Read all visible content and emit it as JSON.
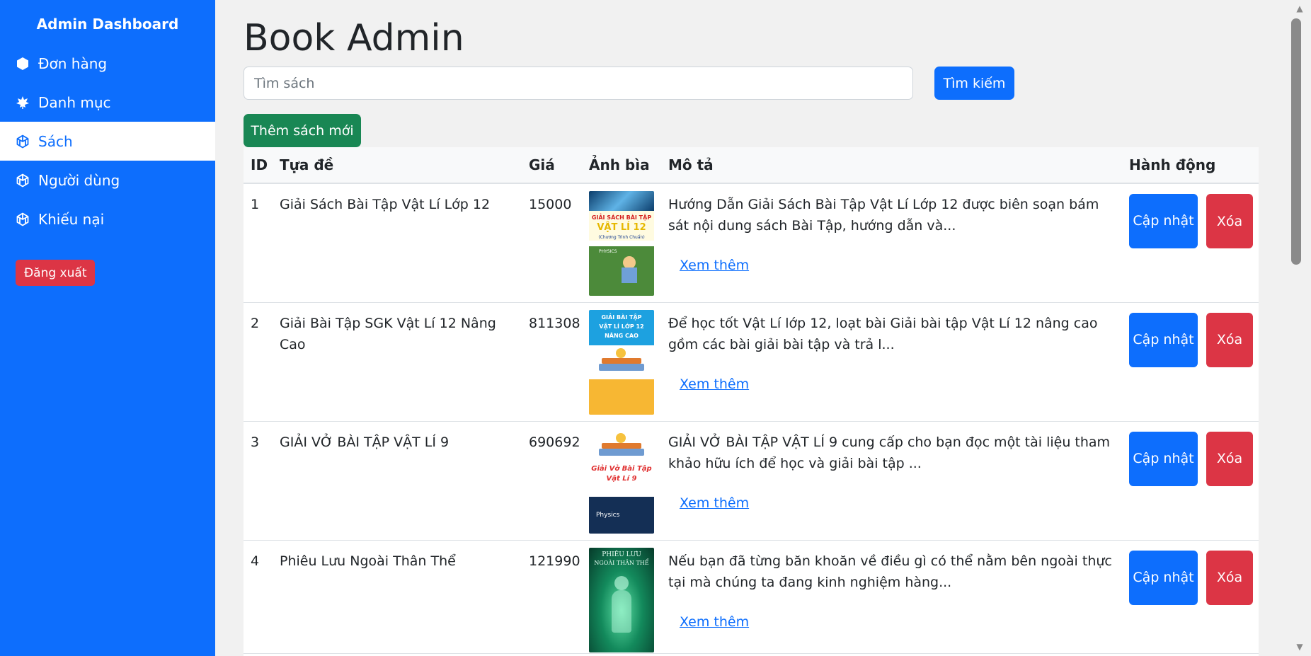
{
  "sidebar": {
    "title": "Admin Dashboard",
    "items": [
      {
        "label": "Đơn hàng",
        "icon": "box-icon"
      },
      {
        "label": "Danh mục",
        "icon": "leaf-icon"
      },
      {
        "label": "Sách",
        "icon": "cube-icon",
        "active": true
      },
      {
        "label": "Người dùng",
        "icon": "cube-icon"
      },
      {
        "label": "Khiếu nại",
        "icon": "cube-icon"
      }
    ],
    "logout_label": "Đăng xuất"
  },
  "main": {
    "title": "Book Admin",
    "search_placeholder": "Tìm sách",
    "search_button": "Tìm kiếm",
    "add_button": "Thêm sách mới",
    "table": {
      "headers": [
        "ID",
        "Tựa đề",
        "Giá",
        "Ảnh bìa",
        "Mô tả",
        "Hành động"
      ],
      "rows": [
        {
          "id": "1",
          "title": "Giải Sách Bài Tập Vật Lí Lớp 12",
          "price": "15000",
          "cover_icon": "book-cover-physics-12",
          "cover_text": [
            "GIẢI SÁCH BÀI TẬP",
            "VẬT LÍ 12",
            "(Chương Trình Chuẩn)",
            "PHYSICS"
          ],
          "description": "Hướng Dẫn Giải Sách Bài Tập Vật Lí Lớp 12 được biên soạn bám sát nội dung sách Bài Tập, hướng dẫn và...",
          "more": "Xem thêm",
          "update": "Cập nhật",
          "delete": "Xóa"
        },
        {
          "id": "2",
          "title": "Giải Bài Tập SGK Vật Lí 12 Nâng Cao",
          "price": "811308",
          "cover_icon": "book-cover-physics-12-advanced",
          "cover_text": [
            "GIẢI BÀI TẬP",
            "VẬT LÍ LỚP 12",
            "NÂNG CAO"
          ],
          "description": "Để học tốt Vật Lí lớp 12, loạt bài Giải bài tập Vật Lí 12 nâng cao gồm các bài giải bài tập và trả l...",
          "more": "Xem thêm",
          "update": "Cập nhật",
          "delete": "Xóa"
        },
        {
          "id": "3",
          "title": "GIẢI VỞ BÀI TẬP VẬT LÍ 9",
          "price": "690692",
          "cover_icon": "book-cover-physics-9",
          "cover_text": [
            "Giải Vở Bài Tập",
            "Vật Lí 9",
            "Physics"
          ],
          "description": "GIẢI VỞ BÀI TẬP VẬT LÍ 9 cung cấp cho bạn đọc một tài liệu tham khảo hữu ích để học và giải bài tập ...",
          "more": "Xem thêm",
          "update": "Cập nhật",
          "delete": "Xóa"
        },
        {
          "id": "4",
          "title": "Phiêu Lưu Ngoài Thân Thể",
          "price": "121990",
          "cover_icon": "book-cover-out-of-body",
          "cover_text": [
            "PHIÊU LƯU",
            "NGOÀI THÂN THỂ"
          ],
          "description": "Nếu bạn đã từng băn khoăn về điều gì có thể nằm bên ngoài thực tại mà chúng ta đang kinh nghiệm hàng...",
          "more": "Xem thêm",
          "update": "Cập nhật",
          "delete": "Xóa"
        }
      ]
    }
  },
  "colors": {
    "primary": "#0d6efd",
    "danger": "#dc3545",
    "success": "#198754",
    "page_bg": "#f1f1f1"
  }
}
